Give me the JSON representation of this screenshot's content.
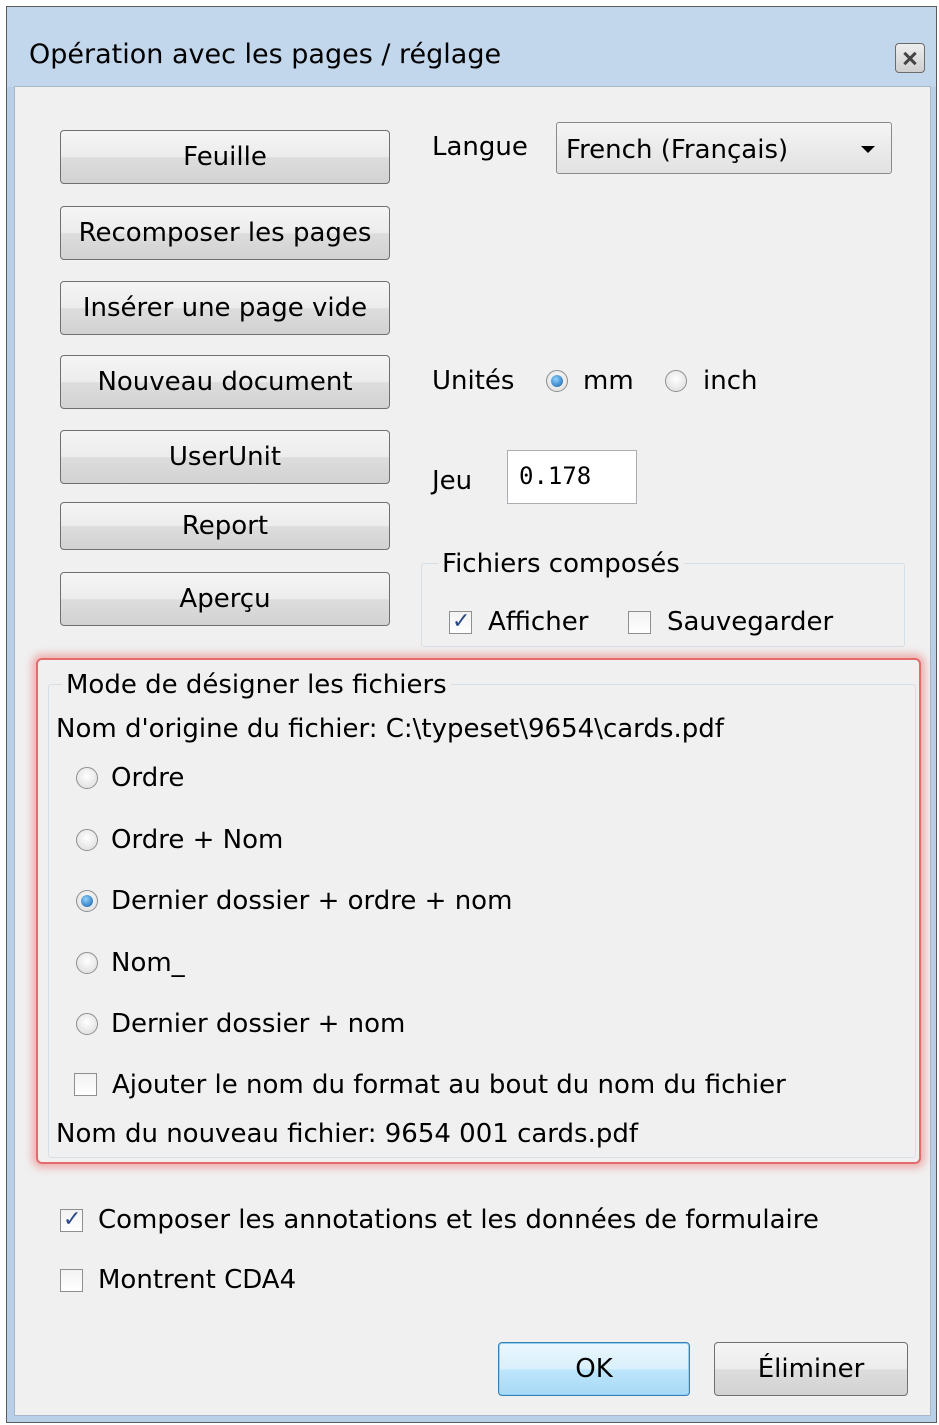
{
  "window": {
    "title": "Opération avec les pages / réglage"
  },
  "left_buttons": [
    {
      "label": "Feuille"
    },
    {
      "label": "Recomposer les pages"
    },
    {
      "label": "Insérer une page vide"
    },
    {
      "label": "Nouveau document"
    },
    {
      "label": "UserUnit"
    },
    {
      "label": "Report"
    },
    {
      "label": "Aperçu"
    }
  ],
  "language": {
    "label": "Langue",
    "selected": "French (Français)"
  },
  "units": {
    "label": "Unités",
    "options": [
      {
        "label": "mm",
        "selected": true
      },
      {
        "label": "inch",
        "selected": false
      }
    ]
  },
  "jeu": {
    "label": "Jeu",
    "value": "0.178"
  },
  "composed_files": {
    "title": "Fichiers composés",
    "show": {
      "label": "Afficher",
      "checked": true
    },
    "save": {
      "label": "Sauvegarder",
      "checked": false
    }
  },
  "naming_mode": {
    "title": "Mode de désigner les fichiers",
    "original_name": "Nom d'origine du fichier: C:\\typeset\\9654\\cards.pdf",
    "options": [
      {
        "label": "Ordre",
        "selected": false
      },
      {
        "label": "Ordre + Nom",
        "selected": false
      },
      {
        "label": "Dernier dossier + ordre + nom",
        "selected": true
      },
      {
        "label": "Nom_",
        "selected": false
      },
      {
        "label": "Dernier dossier + nom",
        "selected": false
      }
    ],
    "append_format": {
      "label": "Ajouter le nom du format au bout du nom du fichier",
      "checked": false
    },
    "new_name": "Nom du nouveau fichier: 9654 001 cards.pdf"
  },
  "compose_annotations": {
    "label": "Composer les annotations et les données de formulaire",
    "checked": true
  },
  "show_cda4": {
    "label": "Montrent CDA4",
    "checked": false
  },
  "footer": {
    "ok_label": "OK",
    "cancel_label": "Éliminer"
  }
}
